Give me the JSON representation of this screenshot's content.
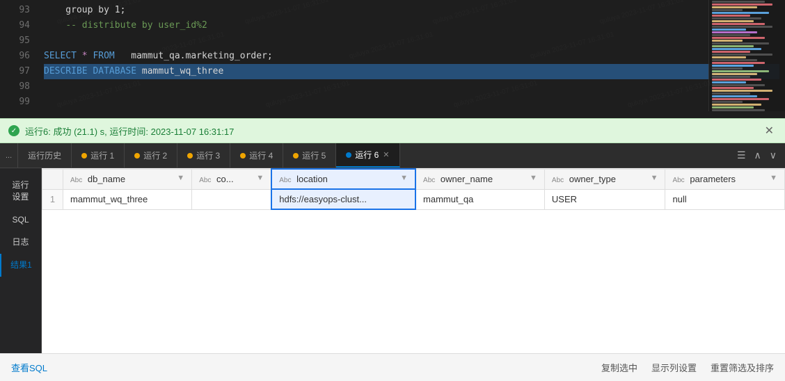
{
  "editor": {
    "lines": [
      {
        "num": "93",
        "content": "    group by 1;",
        "type": "plain"
      },
      {
        "num": "94",
        "content": "    -- distribute by user_id%2",
        "type": "comment"
      },
      {
        "num": "95",
        "content": "",
        "type": "plain"
      },
      {
        "num": "96",
        "content": "SELECT * FROM  mammut_qa.marketing_order;",
        "type": "select"
      },
      {
        "num": "97",
        "content": "DESCRIBE DATABASE mammut_wq_three",
        "type": "describe"
      },
      {
        "num": "98",
        "content": "",
        "type": "plain"
      },
      {
        "num": "99",
        "content": "",
        "type": "plain"
      }
    ]
  },
  "success_bar": {
    "text": "运行6: 成功 (21.1) s, 运行时间: 2023-11-07 16:31:17"
  },
  "tabs": {
    "more_label": "...",
    "items": [
      {
        "label": "运行历史",
        "dot_color": null,
        "active": false
      },
      {
        "label": "运行 1",
        "dot_color": "#f0a500",
        "active": false
      },
      {
        "label": "运行 2",
        "dot_color": "#f0a500",
        "active": false
      },
      {
        "label": "运行 3",
        "dot_color": "#f0a500",
        "active": false
      },
      {
        "label": "运行 4",
        "dot_color": "#f0a500",
        "active": false
      },
      {
        "label": "运行 5",
        "dot_color": "#f0a500",
        "active": false
      },
      {
        "label": "运行 6",
        "dot_color": "#007acc",
        "active": true,
        "closable": true
      }
    ]
  },
  "sidebar": {
    "items": [
      {
        "label": "运行\n设置",
        "active": false
      },
      {
        "label": "SQL",
        "active": false
      },
      {
        "label": "日志",
        "active": false
      },
      {
        "label": "结果1",
        "active": true
      }
    ]
  },
  "table": {
    "columns": [
      {
        "type": "Abc",
        "name": "db_name"
      },
      {
        "type": "Abc",
        "name": "co..."
      },
      {
        "type": "Abc",
        "name": "location"
      },
      {
        "type": "Abc",
        "name": "owner_name"
      },
      {
        "type": "Abc",
        "name": "owner_type"
      },
      {
        "type": "Abc",
        "name": "parameters"
      }
    ],
    "rows": [
      {
        "row_num": "1",
        "cells": [
          "mammut_wq_three",
          "",
          "hdfs://easyops-clust...",
          "mammut_qa",
          "USER",
          "null"
        ]
      }
    ]
  },
  "bottom_bar": {
    "view_sql": "查看SQL",
    "copy_selected": "复制选中",
    "show_columns": "显示列设置",
    "reset_filter": "重置筛选及排序"
  }
}
